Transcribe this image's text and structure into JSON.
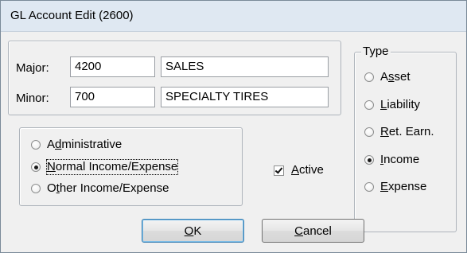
{
  "window": {
    "title": "GL Account Edit (2600)"
  },
  "account": {
    "major_label": "Major:",
    "major_number": "4200",
    "major_name": "SALES",
    "minor_label": "Minor:",
    "minor_number": "700",
    "minor_name": "SPECIALTY TIRES"
  },
  "category": {
    "options": [
      {
        "pre": "A",
        "u": "d",
        "post": "ministrative",
        "checked": false
      },
      {
        "pre": "",
        "u": "N",
        "post": "ormal Income/Expense",
        "checked": true
      },
      {
        "pre": "O",
        "u": "t",
        "post": "her Income/Expense",
        "checked": false
      }
    ]
  },
  "active": {
    "u": "A",
    "post": "ctive",
    "checked": true
  },
  "type": {
    "legend": "Type",
    "options": [
      {
        "pre": "A",
        "u": "s",
        "post": "set",
        "checked": false
      },
      {
        "pre": "",
        "u": "L",
        "post": "iability",
        "checked": false
      },
      {
        "pre": "",
        "u": "R",
        "post": "et. Earn.",
        "checked": false
      },
      {
        "pre": "",
        "u": "I",
        "post": "ncome",
        "checked": true
      },
      {
        "pre": "",
        "u": "E",
        "post": "xpense",
        "checked": false
      }
    ]
  },
  "buttons": {
    "ok": {
      "pre": "",
      "u": "O",
      "post": "K"
    },
    "cancel": {
      "pre": "",
      "u": "C",
      "post": "ancel"
    }
  },
  "colors": {
    "titlebar": "#dfe8f2",
    "window_bg": "#f0f0f0",
    "default_button_border": "#3c7fb1"
  }
}
